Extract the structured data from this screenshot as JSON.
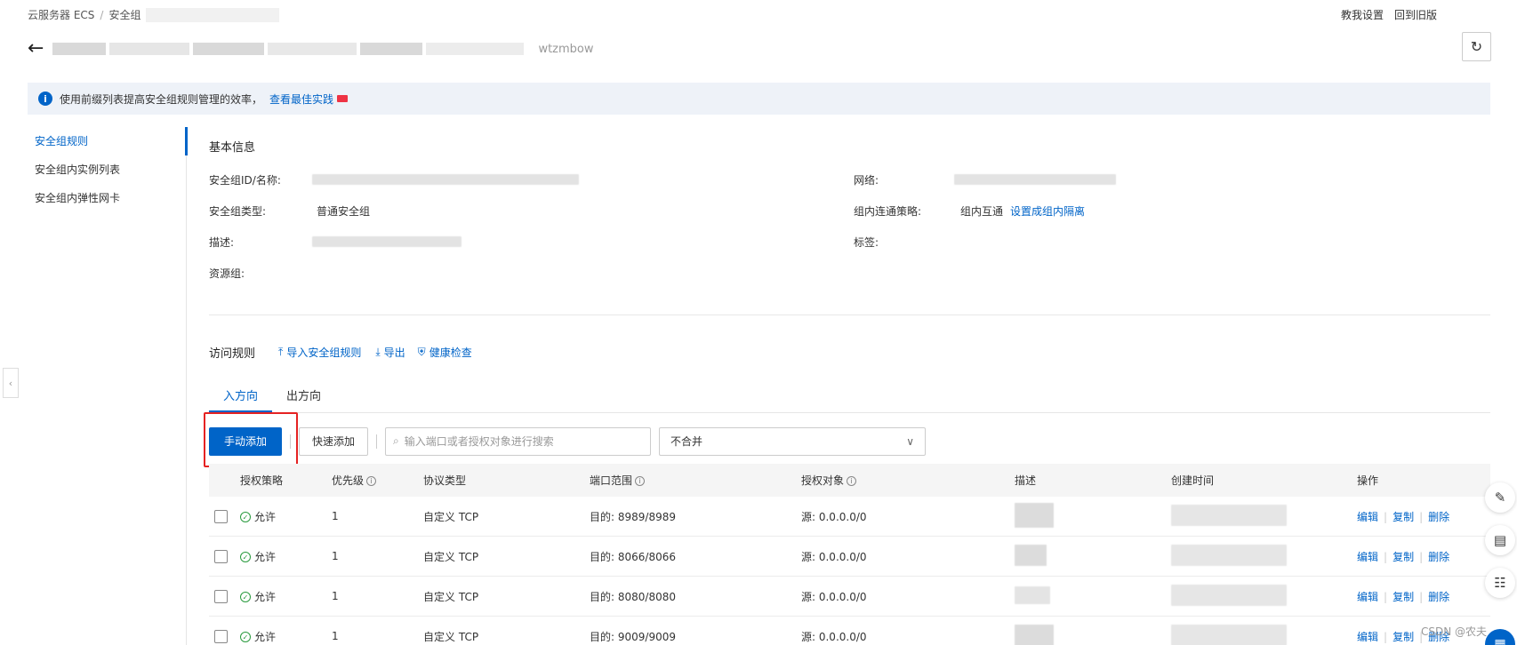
{
  "breadcrumb": {
    "items": [
      "云服务器 ECS",
      "安全组"
    ],
    "separator": "/"
  },
  "header_links": {
    "tutorial": "教我设置",
    "old_version": "回到旧版"
  },
  "page_title": {
    "suffix": "wtzmbow"
  },
  "banner": {
    "text": "使用前缀列表提高安全组规则管理的效率，",
    "link": "查看最佳实践"
  },
  "sidebar": {
    "items": [
      {
        "label": "安全组规则",
        "active": true
      },
      {
        "label": "安全组内实例列表",
        "active": false
      },
      {
        "label": "安全组内弹性网卡",
        "active": false
      }
    ]
  },
  "basic_info": {
    "title": "基本信息",
    "id_label": "安全组ID/名称:",
    "type_label": "安全组类型:",
    "type_value": "普通安全组",
    "desc_label": "描述:",
    "rg_label": "资源组:",
    "network_label": "网络:",
    "policy_label": "组内连通策略:",
    "policy_value": "组内互通",
    "policy_link": "设置成组内隔离",
    "tag_label": "标签:"
  },
  "rules": {
    "title": "访问规则",
    "import": "导入安全组规则",
    "export": "导出",
    "health": "健康检查",
    "tabs": [
      "入方向",
      "出方向"
    ],
    "add_manual": "手动添加",
    "add_quick": "快速添加",
    "search_placeholder": "输入端口或者授权对象进行搜索",
    "merge_select": "不合并",
    "columns": [
      "授权策略",
      "优先级",
      "协议类型",
      "端口范围",
      "授权对象",
      "描述",
      "创建时间",
      "操作"
    ],
    "ops": [
      "编辑",
      "复制",
      "删除"
    ],
    "rows": [
      {
        "policy": "允许",
        "priority": "1",
        "protocol": "自定义 TCP",
        "port": "目的: 8989/8989",
        "object": "源: 0.0.0.0/0"
      },
      {
        "policy": "允许",
        "priority": "1",
        "protocol": "自定义 TCP",
        "port": "目的: 8066/8066",
        "object": "源: 0.0.0.0/0"
      },
      {
        "policy": "允许",
        "priority": "1",
        "protocol": "自定义 TCP",
        "port": "目的: 8080/8080",
        "object": "源: 0.0.0.0/0"
      },
      {
        "policy": "允许",
        "priority": "1",
        "protocol": "自定义 TCP",
        "port": "目的: 9009/9009",
        "object": "源: 0.0.0.0/0"
      }
    ]
  },
  "watermark": "CSDN @农夫",
  "colors": {
    "primary": "#0064c8",
    "success": "#2a9b3e",
    "highlight": "#e52222"
  }
}
